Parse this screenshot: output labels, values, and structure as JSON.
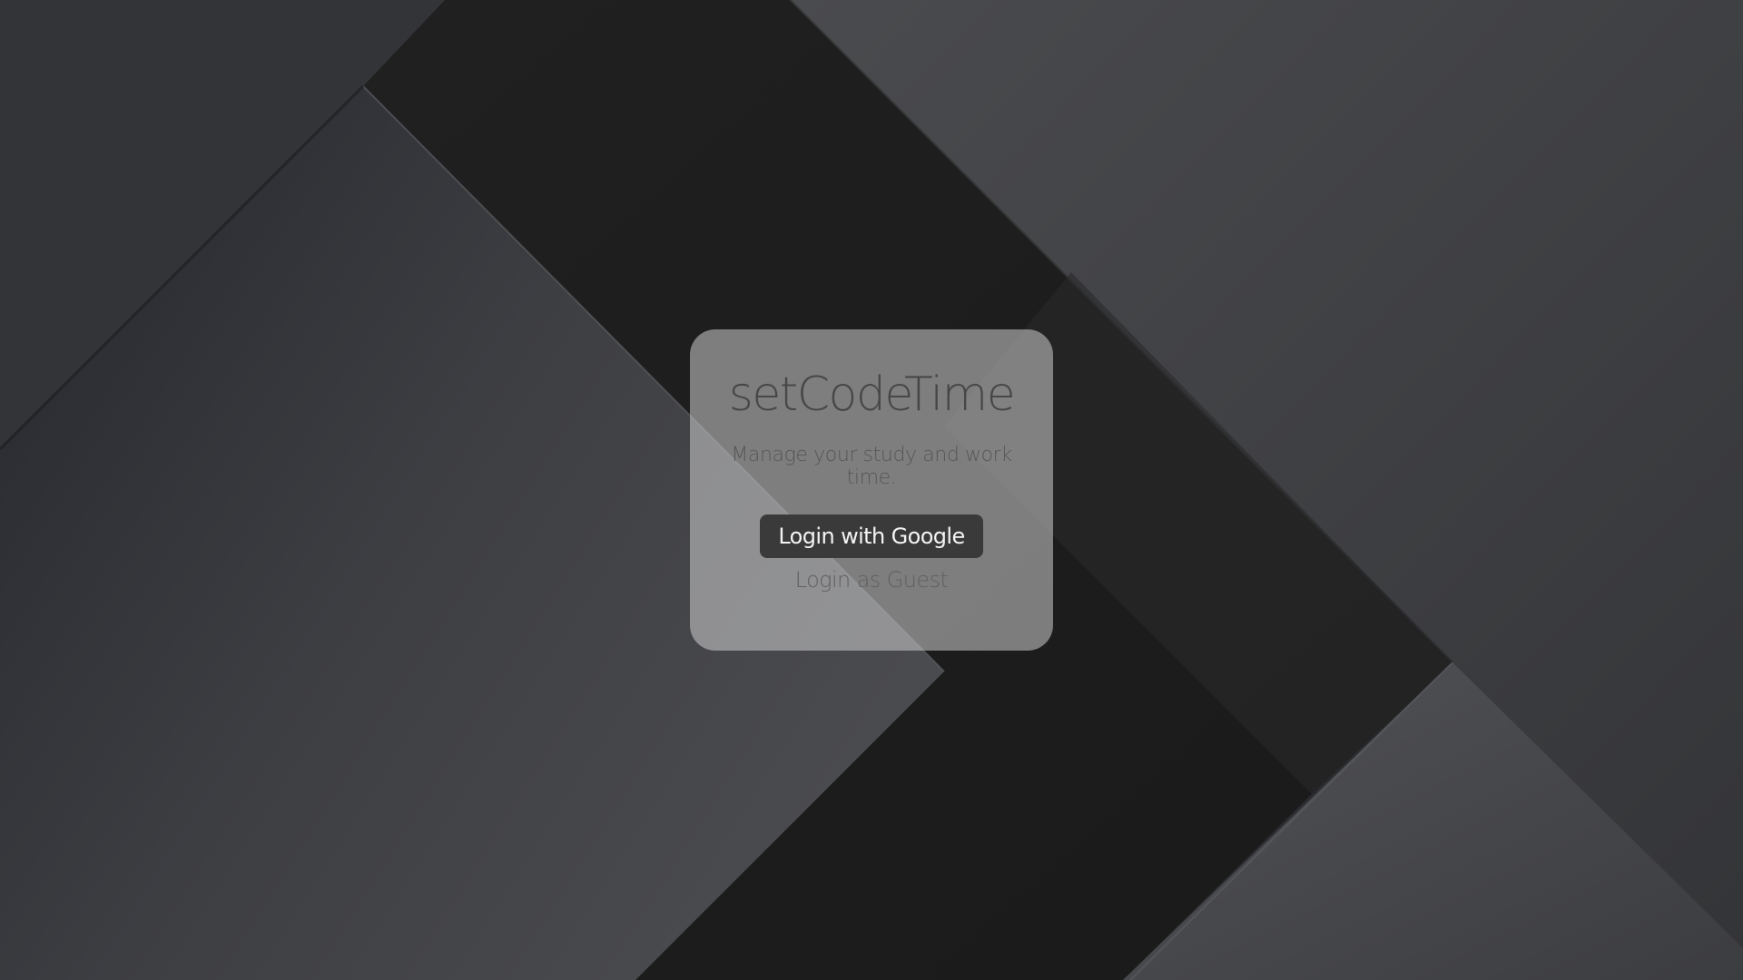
{
  "app": {
    "title": "setCodeTime",
    "subtitle": "Manage your study and work time."
  },
  "actions": {
    "google_login_label": "Login with Google",
    "guest_login_label": "Login as Guest"
  },
  "colors": {
    "card_background": "#cdcdcd",
    "primary_button": "#3a3a3a",
    "primary_button_text": "#f4f4f4",
    "background_dark": "#1d1d1d",
    "background_mid": "#3a3b3e"
  }
}
